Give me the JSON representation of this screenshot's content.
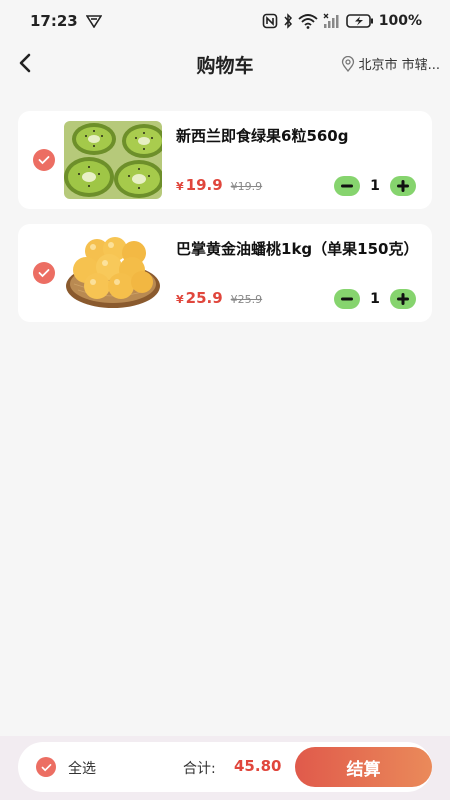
{
  "status_bar": {
    "time": "17:23",
    "battery": "100%"
  },
  "header": {
    "title": "购物车",
    "location": "北京市 市辖..."
  },
  "cart": {
    "items": [
      {
        "name": "新西兰即食绿果6粒560g",
        "currency": "¥",
        "price": "19.9",
        "original_price": "¥19.9",
        "quantity": "1",
        "image": "kiwi-fruit-photo",
        "selected": true
      },
      {
        "name": "巴掌黄金油蟠桃1kg（单果150克）",
        "currency": "¥",
        "price": "25.9",
        "original_price": "¥25.9",
        "quantity": "1",
        "image": "golden-flat-peach-photo",
        "selected": true
      }
    ]
  },
  "footer": {
    "select_all_label": "全选",
    "total_label": "合计:",
    "total_value": "45.80",
    "checkout_label": "结算"
  },
  "colors": {
    "accent": "#ec6e63",
    "price": "#e0463c",
    "stepper": "#86d46e",
    "checkout_gradient_start": "#e05a4b",
    "checkout_gradient_end": "#ea8a5a"
  }
}
